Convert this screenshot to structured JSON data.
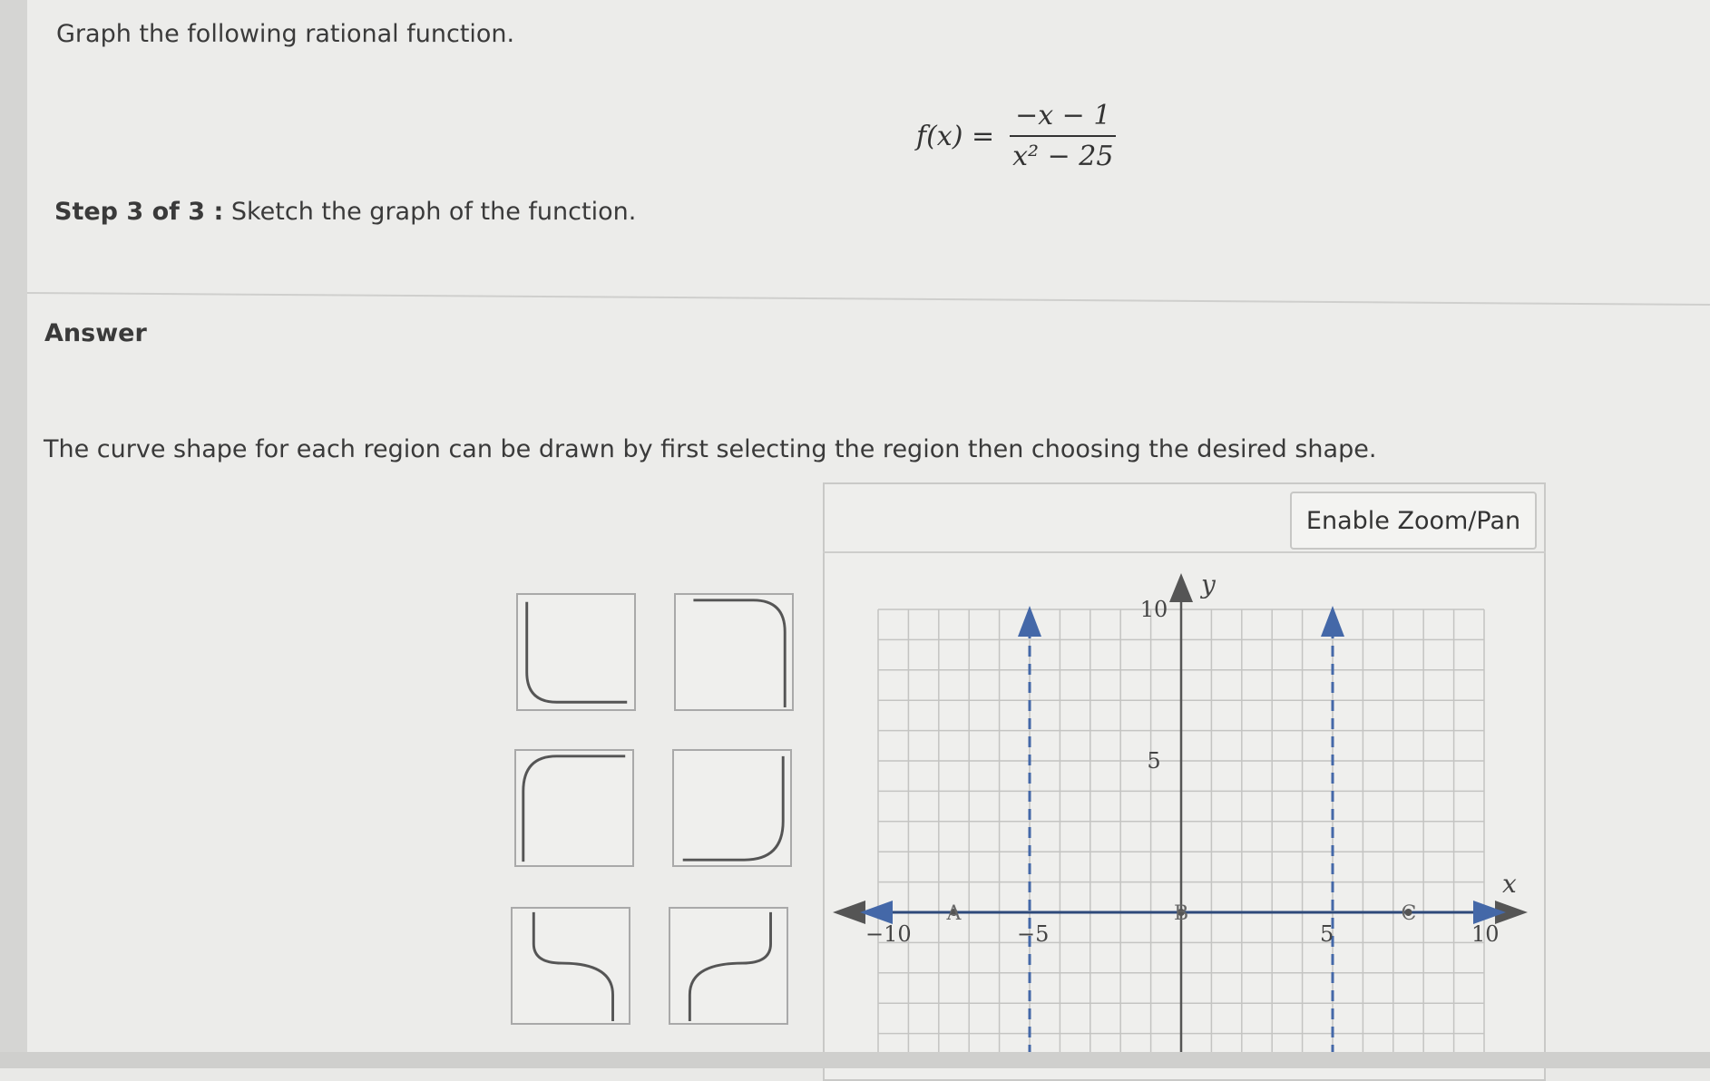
{
  "question": {
    "instruction": "Graph the following rational function.",
    "formula_lhs": "f(x) =",
    "formula_numerator": "−x − 1",
    "formula_denominator": "x² − 25",
    "step_label": "Step 3 of 3 :",
    "step_text": "Sketch the graph of the function."
  },
  "answer": {
    "heading": "Answer",
    "hint": "The curve shape for each region can be drawn by first selecting the region then choosing the desired shape."
  },
  "shapes": [
    {
      "name": "shape-u-bottom-left"
    },
    {
      "name": "shape-top-right-corner"
    },
    {
      "name": "shape-top-left-corner"
    },
    {
      "name": "shape-bottom-right-corner"
    },
    {
      "name": "shape-s-descending"
    },
    {
      "name": "shape-s-ascending"
    }
  ],
  "graph": {
    "zoom_button_label": "Enable Zoom/Pan",
    "x_axis_label": "x",
    "y_axis_label": "y",
    "x_range": [
      -10,
      10
    ],
    "y_range": [
      -10,
      10
    ],
    "x_tick_labels": [
      "−10",
      "−5",
      "5",
      "10"
    ],
    "y_tick_labels": [
      "10",
      "5"
    ],
    "vertical_asymptotes": [
      -5,
      5
    ],
    "region_points": [
      {
        "label": "A",
        "x": -7.5
      },
      {
        "label": "B",
        "x": 0
      },
      {
        "label": "C",
        "x": 7.5
      }
    ],
    "axis_color": "#2e4a7a",
    "asymptote_color": "#4468a8"
  }
}
